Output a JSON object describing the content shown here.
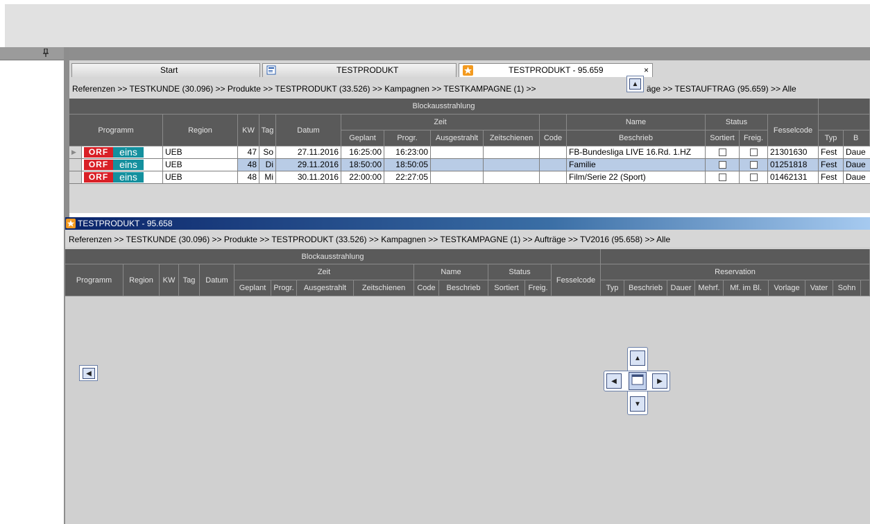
{
  "panel": {
    "pin_icon": "pin-icon"
  },
  "tabs": [
    {
      "label": "Start"
    },
    {
      "label": "TESTPRODUKT"
    },
    {
      "label": "TESTPRODUKT - 95.659",
      "close": "×"
    }
  ],
  "breadcrumb1": "Referenzen  >>  TESTKUNDE (30.096)  >>  Produkte  >>  TESTPRODUKT (33.526)  >>  Kampagnen  >>  TESTKAMPAGNE (1)  >>",
  "breadcrumb1_tail": "äge  >>  TESTAUFTRAG (95.659)  >>  Alle",
  "grid1": {
    "group_title": "Blockausstrahlung",
    "col_zeit": "Zeit",
    "col_name": "Name",
    "col_status": "Status",
    "headers": {
      "programm": "Programm",
      "region": "Region",
      "kw": "KW",
      "tag": "Tag",
      "datum": "Datum",
      "geplant": "Geplant",
      "progr": "Progr.",
      "ausgestrahlt": "Ausgestrahlt",
      "zeitschienen": "Zeitschienen",
      "code": "Code",
      "beschrieb": "Beschrieb",
      "sortiert": "Sortiert",
      "freig": "Freig.",
      "fesselcode": "Fesselcode",
      "typ": "Typ",
      "b": "B"
    },
    "logo": {
      "red": "ORF",
      "teal": "eins"
    },
    "rows": [
      {
        "region": "UEB",
        "kw": "47",
        "tag": "So",
        "datum": "27.11.2016",
        "geplant": "16:25:00",
        "progr": "16:23:00",
        "beschrieb": "FB-Bundesliga LIVE 16.Rd. 1.HZ",
        "fesselcode": "21301630",
        "typ": "Fest",
        "dauer": "Daue"
      },
      {
        "region": "UEB",
        "kw": "48",
        "tag": "Di",
        "datum": "29.11.2016",
        "geplant": "18:50:00",
        "progr": "18:50:05",
        "beschrieb": "Familie",
        "fesselcode": "01251818",
        "typ": "Fest",
        "dauer": "Daue"
      },
      {
        "region": "UEB",
        "kw": "48",
        "tag": "Mi",
        "datum": "30.11.2016",
        "geplant": "22:00:00",
        "progr": "22:27:05",
        "beschrieb": "Film/Serie 22 (Sport)",
        "fesselcode": "01462131",
        "typ": "Fest",
        "dauer": "Daue"
      }
    ]
  },
  "window2": {
    "title": "TESTPRODUKT - 95.658",
    "breadcrumb": "Referenzen  >>  TESTKUNDE (30.096)  >>  Produkte  >>  TESTPRODUKT (33.526)  >>  Kampagnen  >>  TESTKAMPAGNE (1)  >>  Aufträge  >>  TV2016 (95.658)  >>  Alle",
    "group_title": "Blockausstrahlung",
    "reservation": "Reservation",
    "col_zeit": "Zeit",
    "col_name": "Name",
    "col_status": "Status",
    "fesselcode": "Fesselcode",
    "headers": {
      "programm": "Programm",
      "region": "Region",
      "kw": "KW",
      "tag": "Tag",
      "datum": "Datum",
      "geplant": "Geplant",
      "progr": "Progr.",
      "ausgestrahlt": "Ausgestrahlt",
      "zeitschienen": "Zeitschienen",
      "code": "Code",
      "beschrieb": "Beschrieb",
      "sortiert": "Sortiert",
      "freig": "Freig.",
      "typ": "Typ",
      "res_beschrieb": "Beschrieb",
      "dauer": "Dauer",
      "mehrf": "Mehrf.",
      "mf_im_bl": "Mf. im Bl.",
      "vorlage": "Vorlage",
      "vater": "Vater",
      "sohn": "Sohn"
    }
  }
}
